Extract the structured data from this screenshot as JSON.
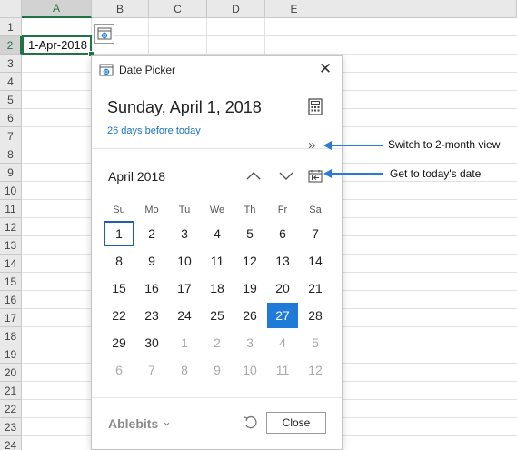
{
  "sheet": {
    "columns": [
      "A",
      "B",
      "C",
      "D",
      "E"
    ],
    "rows": [
      "1",
      "2",
      "3",
      "4",
      "5",
      "6",
      "7",
      "8",
      "9",
      "10",
      "11",
      "12",
      "13",
      "14",
      "15",
      "16",
      "17",
      "18",
      "19",
      "20",
      "21",
      "22",
      "23",
      "24"
    ],
    "active_cell_value": "1-Apr-2018"
  },
  "dialog": {
    "title": "Date Picker",
    "close_glyph": "✕",
    "full_date": "Sunday, April 1, 2018",
    "relative_text": "26 days before today",
    "expand_glyph": "»",
    "month_label": "April 2018",
    "weekdays": [
      "Su",
      "Mo",
      "Tu",
      "We",
      "Th",
      "Fr",
      "Sa"
    ],
    "weeks": [
      [
        "1",
        "2",
        "3",
        "4",
        "5",
        "6",
        "7"
      ],
      [
        "8",
        "9",
        "10",
        "11",
        "12",
        "13",
        "14"
      ],
      [
        "15",
        "16",
        "17",
        "18",
        "19",
        "20",
        "21"
      ],
      [
        "22",
        "23",
        "24",
        "25",
        "26",
        "27",
        "28"
      ],
      [
        "29",
        "30",
        "1",
        "2",
        "3",
        "4",
        "5"
      ],
      [
        "6",
        "7",
        "8",
        "9",
        "10",
        "11",
        "12"
      ]
    ],
    "brand_label": "Ablebits",
    "brand_chevron": "⌄",
    "close_button_label": "Close"
  },
  "annotations": {
    "two_month_view": "Switch to 2-month view",
    "today": "Get to today's date"
  },
  "colors": {
    "accent": "#1f7ad8",
    "excel_green": "#217346",
    "link": "#1a73c8",
    "annotation_arrow": "#2a7bd6"
  },
  "icons": {
    "dialog_title": "date-picker-icon",
    "calculator": "calculator-icon",
    "nav_up": "chevron-up-icon",
    "nav_down": "chevron-down-icon",
    "today": "go-to-today-icon",
    "undo": "undo-icon"
  }
}
